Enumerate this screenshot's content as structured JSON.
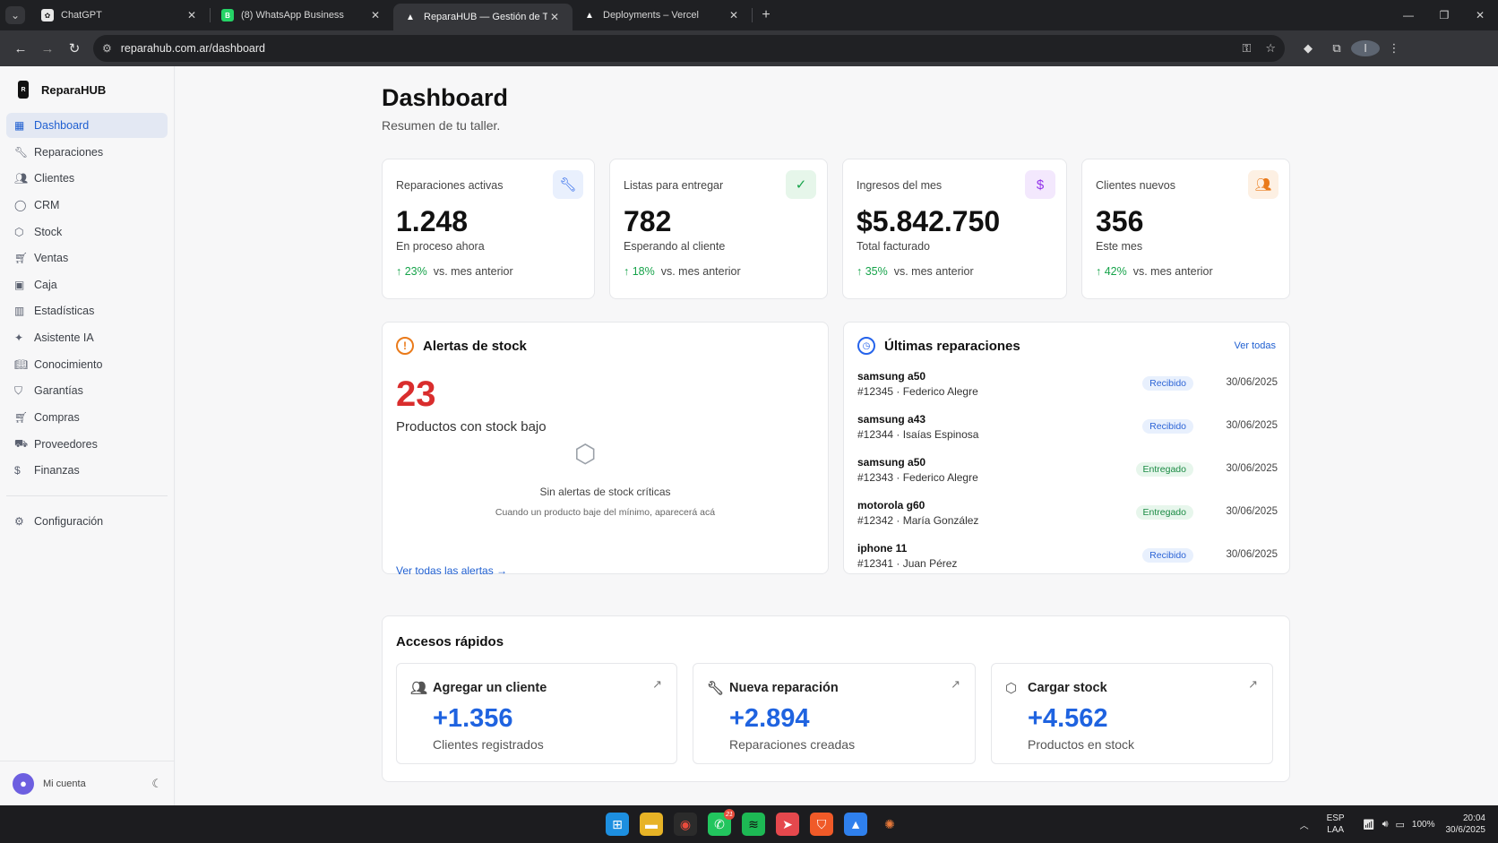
{
  "browser": {
    "tabs": [
      {
        "title": "ChatGPT",
        "favicon": "chatgpt-icon",
        "active": false
      },
      {
        "title": "(8) WhatsApp Business",
        "favicon": "whatsapp-icon",
        "active": false
      },
      {
        "title": "ReparaHUB — Gestión de Taller",
        "favicon": "triangle-icon",
        "active": true
      },
      {
        "title": "Deployments – Vercel",
        "favicon": "triangle-icon",
        "active": false
      }
    ],
    "url": "reparahub.com.ar/dashboard"
  },
  "sidebar": {
    "brand": "ReparaHUB",
    "items": [
      {
        "label": "Dashboard",
        "icon": "grid-icon",
        "active": true
      },
      {
        "label": "Reparaciones",
        "icon": "wrench-icon"
      },
      {
        "label": "Clientes",
        "icon": "users-icon"
      },
      {
        "label": "CRM",
        "icon": "chat-icon"
      },
      {
        "label": "Stock",
        "icon": "package-icon"
      },
      {
        "label": "Ventas",
        "icon": "cart-icon"
      },
      {
        "label": "Caja",
        "icon": "cash-box-icon"
      },
      {
        "label": "Estadísticas",
        "icon": "bar-chart-icon"
      },
      {
        "label": "Asistente IA",
        "icon": "sparkles-icon"
      },
      {
        "label": "Conocimiento",
        "icon": "book-icon"
      },
      {
        "label": "Garantías",
        "icon": "shield-icon"
      },
      {
        "label": "Compras",
        "icon": "cart-icon"
      },
      {
        "label": "Proveedores",
        "icon": "truck-icon"
      },
      {
        "label": "Finanzas",
        "icon": "dollar-icon"
      }
    ],
    "settings": {
      "label": "Configuración",
      "icon": "gear-icon"
    },
    "account": "Mi cuenta"
  },
  "header": {
    "title": "Dashboard",
    "subtitle": "Resumen de tu taller."
  },
  "kpis": [
    {
      "label": "Reparaciones activas",
      "value": "1.248",
      "sub": "En proceso ahora",
      "trend": "23%",
      "trend_text": "vs. mes anterior",
      "icon": "wrench-icon",
      "accent": "#2563eb"
    },
    {
      "label": "Listas para entregar",
      "value": "782",
      "sub": "Esperando al cliente",
      "trend": "18%",
      "trend_text": "vs. mes anterior",
      "icon": "check-circle-icon",
      "accent": "#16a34a"
    },
    {
      "label": "Ingresos del mes",
      "value": "$5.842.750",
      "sub": "Total facturado",
      "trend": "35%",
      "trend_text": "vs. mes anterior",
      "icon": "dollar-icon",
      "accent": "#9333ea"
    },
    {
      "label": "Clientes nuevos",
      "value": "356",
      "sub": "Este mes",
      "trend": "42%",
      "trend_text": "vs. mes anterior",
      "icon": "users-icon",
      "accent": "#ea7a1a"
    }
  ],
  "stock_alerts": {
    "title": "Alertas de stock",
    "count": "23",
    "count_label": "Productos con stock bajo",
    "empty_title": "Sin alertas de stock críticas",
    "empty_sub": "Cuando un producto baje del mínimo, aparecerá acá",
    "link": "Ver todas las alertas"
  },
  "recent_repairs": {
    "title": "Últimas reparaciones",
    "link": "Ver todas",
    "rows": [
      {
        "device": "samsung a50",
        "meta": "#12345 · Federico Alegre",
        "status": "Recibido",
        "date": "30/06/2025"
      },
      {
        "device": "samsung a43",
        "meta": "#12344 · Isaías Espinosa",
        "status": "Recibido",
        "date": "30/06/2025"
      },
      {
        "device": "samsung a50",
        "meta": "#12343 · Federico Alegre",
        "status": "Entregado",
        "date": "30/06/2025"
      },
      {
        "device": "motorola g60",
        "meta": "#12342 · María González",
        "status": "Entregado",
        "date": "30/06/2025"
      },
      {
        "device": "iphone 11",
        "meta": "#12341 · Juan Pérez",
        "status": "Recibido",
        "date": "30/06/2025"
      }
    ]
  },
  "quick_access": {
    "title": "Accesos rápidos",
    "cards": [
      {
        "label": "Agregar un cliente",
        "value": "+1.356",
        "sub": "Clientes registrados",
        "icon": "users-icon"
      },
      {
        "label": "Nueva reparación",
        "value": "+2.894",
        "sub": "Reparaciones creadas",
        "icon": "wrench-icon"
      },
      {
        "label": "Cargar stock",
        "value": "+4.562",
        "sub": "Productos en stock",
        "icon": "package-icon"
      }
    ]
  },
  "taskbar": {
    "lang_top": "ESP",
    "lang_bottom": "LAA",
    "battery": "100%",
    "time": "20:04",
    "date": "30/6/2025",
    "whatsapp_badge": "21"
  }
}
